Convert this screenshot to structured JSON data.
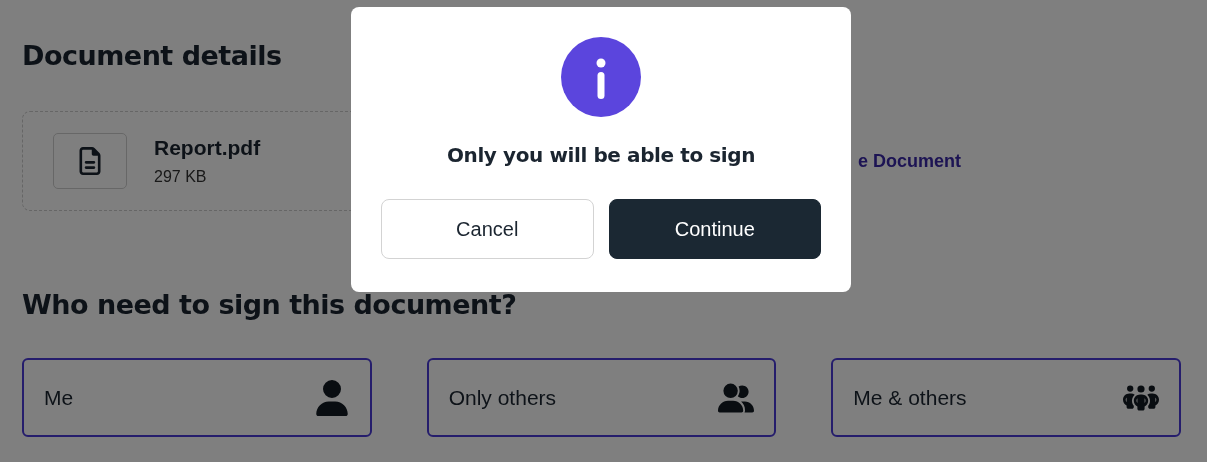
{
  "document_details": {
    "title": "Document details",
    "file": {
      "name": "Report.pdf",
      "size": "297 KB"
    },
    "link": "e Document"
  },
  "signers": {
    "title": "Who need to sign this document?",
    "options": [
      {
        "label": "Me",
        "kind": "single"
      },
      {
        "label": "Only others",
        "kind": "pair"
      },
      {
        "label": "Me & others",
        "kind": "group"
      }
    ]
  },
  "dialog": {
    "message": "Only you will be able to sign",
    "buttons": [
      {
        "label": "Cancel",
        "kind": "secondary"
      },
      {
        "label": "Continue",
        "kind": "primary"
      }
    ]
  }
}
